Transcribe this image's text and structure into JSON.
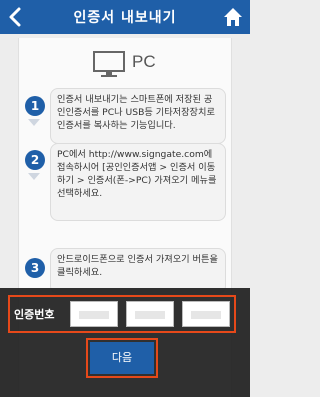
{
  "header": {
    "title": "인증서 내보내기"
  },
  "section": {
    "label": "PC"
  },
  "steps": [
    {
      "num": "1",
      "text": "인증서 내보내기는 스마트폰에 저장된 공인인증서를 PC나 USB등 기타저장장치로 인증서를 복사하는 기능입니다."
    },
    {
      "num": "2",
      "text": "PC에서 http://www.signgate.com에 접속하시어 [공인인증서앱 > 인증서 이동하기 > 인증서(폰->PC) 가져오기 메뉴를 선택하세요."
    },
    {
      "num": "3",
      "text": "안드로이드폰으로 인증서 가져오기 버튼을 클릭하세요."
    }
  ],
  "cert": {
    "label": "인증번호",
    "inputs": [
      "",
      "",
      ""
    ]
  },
  "next_button": {
    "label": "다음"
  },
  "colors": {
    "primary": "#1f5fa8",
    "highlight": "#e6491a",
    "overlay": "#1e1e1e"
  },
  "icons": {
    "back": "chevron-left-icon",
    "home": "home-icon",
    "pc": "monitor-icon"
  }
}
